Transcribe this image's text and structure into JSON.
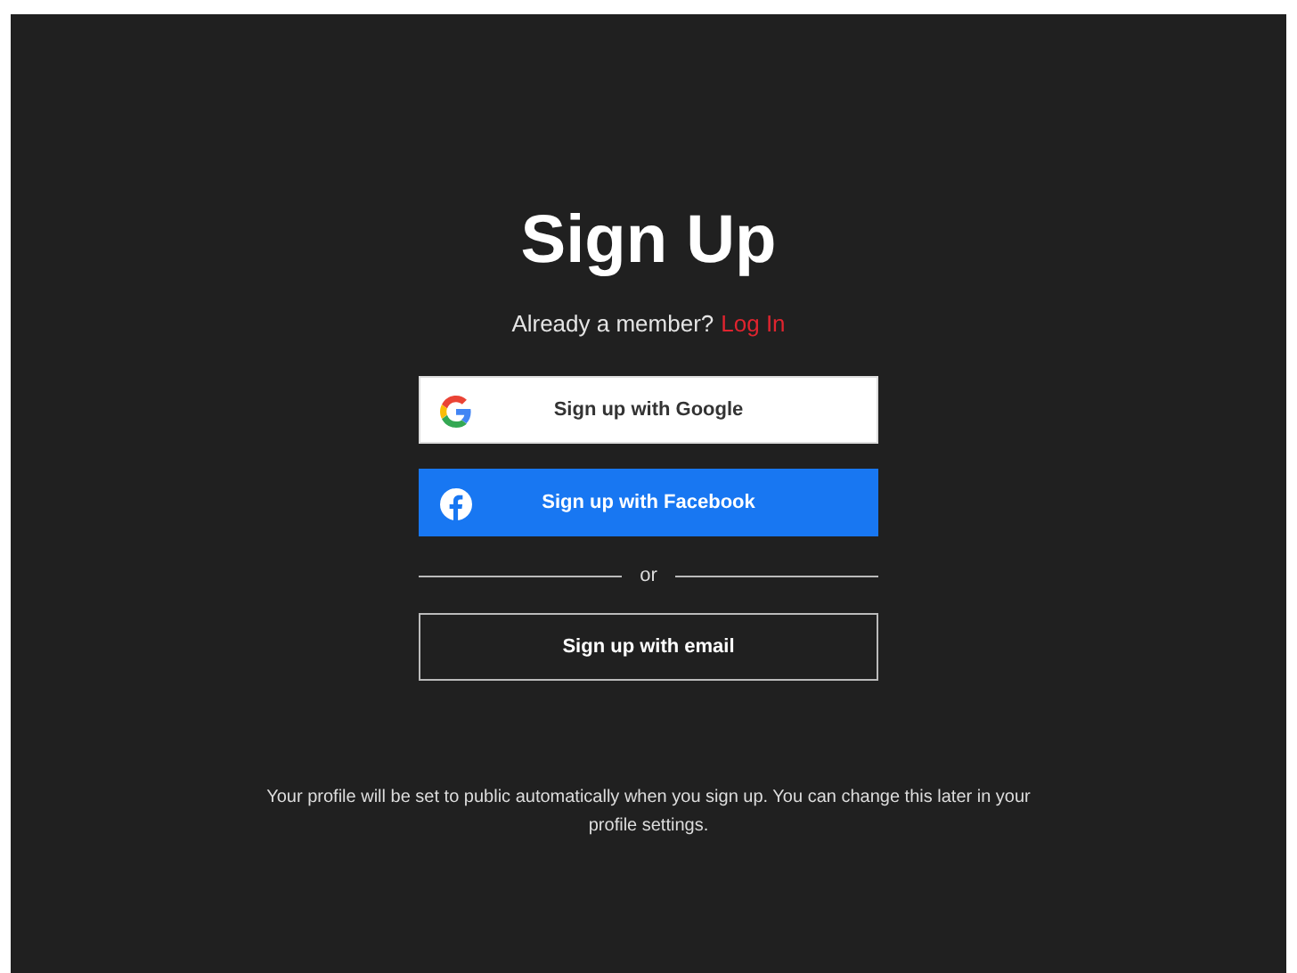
{
  "title": "Sign Up",
  "member_prompt": {
    "text": "Already a member?",
    "link": "Log In"
  },
  "buttons": [
    {
      "kind": "google",
      "label": "Sign up with Google"
    },
    {
      "kind": "facebook",
      "label": "Sign up with Facebook"
    }
  ],
  "divider": "or",
  "email_button": {
    "kind": "email",
    "label": "Sign up with email"
  },
  "notice": "Your profile will be set to public automatically when you sign up. You can change this later in your profile settings."
}
